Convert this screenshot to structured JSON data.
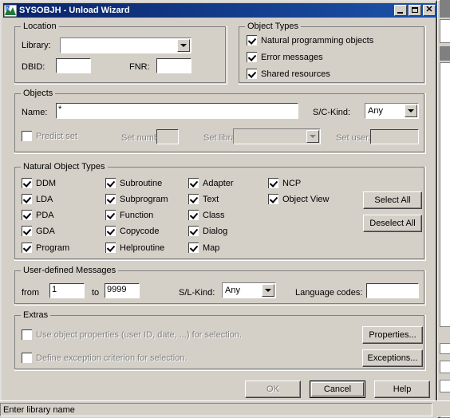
{
  "window": {
    "title": "SYSOBJH - Unload Wizard",
    "icon": "app-icon",
    "buttons": {
      "minimize": "minimize-icon",
      "maximize": "maximize-icon",
      "close": "close-icon"
    }
  },
  "location": {
    "legend": "Location",
    "library_label": "Library:",
    "library_value": "",
    "dbid_label": "DBID:",
    "dbid_value": "",
    "fnr_label": "FNR:",
    "fnr_value": ""
  },
  "object_types": {
    "legend": "Object Types",
    "items": [
      {
        "label": "Natural programming objects",
        "checked": true
      },
      {
        "label": "Error messages",
        "checked": true
      },
      {
        "label": "Shared resources",
        "checked": true
      }
    ]
  },
  "objects": {
    "legend": "Objects",
    "name_label": "Name:",
    "name_value": "*",
    "sc_kind_label": "S/C-Kind:",
    "sc_kind_value": "Any",
    "predict_set_label": "Predict set",
    "predict_set_checked": false,
    "set_number_label": "Set number:",
    "set_number_value": "",
    "set_library_label": "Set library:",
    "set_library_value": "",
    "set_user_label": "Set user:",
    "set_user_value": ""
  },
  "natural_object_types": {
    "legend": "Natural Object Types",
    "column1": [
      {
        "label": "DDM",
        "checked": true
      },
      {
        "label": "LDA",
        "checked": true
      },
      {
        "label": "PDA",
        "checked": true
      },
      {
        "label": "GDA",
        "checked": true
      },
      {
        "label": "Program",
        "checked": true
      }
    ],
    "column2": [
      {
        "label": "Subroutine",
        "checked": true
      },
      {
        "label": "Subprogram",
        "checked": true
      },
      {
        "label": "Function",
        "checked": true
      },
      {
        "label": "Copycode",
        "checked": true
      },
      {
        "label": "Helproutine",
        "checked": true
      }
    ],
    "column3": [
      {
        "label": "Adapter",
        "checked": true
      },
      {
        "label": "Text",
        "checked": true
      },
      {
        "label": "Class",
        "checked": true
      },
      {
        "label": "Dialog",
        "checked": true
      },
      {
        "label": "Map",
        "checked": true
      }
    ],
    "column4": [
      {
        "label": "NCP",
        "checked": true
      },
      {
        "label": "Object View",
        "checked": true
      }
    ],
    "select_all_label": "Select All",
    "deselect_all_label": "Deselect All"
  },
  "user_defined_messages": {
    "legend": "User-defined Messages",
    "from_label": "from",
    "from_value": "1",
    "to_label": "to",
    "to_value": "9999",
    "sl_kind_label": "S/L-Kind:",
    "sl_kind_value": "Any",
    "language_codes_label": "Language codes:",
    "language_codes_value": ""
  },
  "extras": {
    "legend": "Extras",
    "use_object_properties_label": "Use object properties (user ID, date, ...)  for selection.",
    "use_object_properties_checked": false,
    "define_exception_label": "Define exception criterion for selection.",
    "define_exception_checked": false,
    "properties_button": "Properties...",
    "exceptions_button": "Exceptions..."
  },
  "footer": {
    "ok_label": "OK",
    "cancel_label": "Cancel",
    "help_label": "Help"
  },
  "statusbar": {
    "message": "Enter library name"
  },
  "colors": {
    "face": "#d4d0c8",
    "titlebar": "#0a246a",
    "title_text": "#ffffff",
    "disabled_text": "#808080",
    "field_bg": "#ffffff"
  }
}
